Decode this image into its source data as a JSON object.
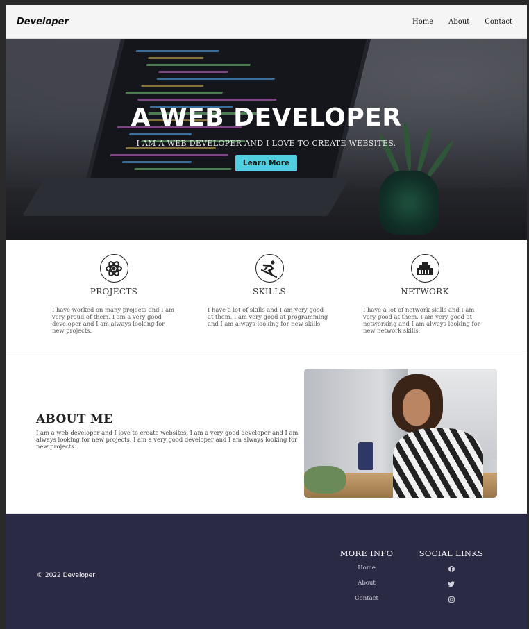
{
  "nav": {
    "logo": "Developer",
    "links": [
      "Home",
      "About",
      "Contact"
    ]
  },
  "hero": {
    "title": "A WEB DEVELOPER",
    "subtitle": "I AM A WEB DEVELOPER AND I LOVE TO CREATE WEBSITES.",
    "button_label": "Learn More"
  },
  "services": [
    {
      "icon": "atom-icon",
      "title": "PROJECTS",
      "text": "I have worked on many projects and I am very proud of them. I am a very good developer and I am always looking for new projects."
    },
    {
      "icon": "skier-icon",
      "title": "SKILLS",
      "text": "I have a lot of skills and I am very good at them. I am very good at programming and I am always looking for new skills."
    },
    {
      "icon": "network-icon",
      "title": "NETWORK",
      "text": "I have a lot of network skills and I am very good at them. I am very good at networking and I am always looking for new network skills."
    }
  ],
  "about": {
    "title": "ABOUT ME",
    "body": "I am a web developer and I love to create websites. I am a very good developer and I am always looking for new projects. I am a very good developer and I am always looking for new projects."
  },
  "footer": {
    "copyright": "© 2022 Developer",
    "more_info_title": "MORE INFO",
    "more_info_links": [
      "Home",
      "About",
      "Contact"
    ],
    "social_title": "SOCIAL LINKS",
    "social_icons": [
      "facebook-icon",
      "twitter-icon",
      "instagram-icon"
    ]
  },
  "colors": {
    "accent": "#4fcfdf",
    "footer_bg": "#2b2a44",
    "nav_bg": "#f5f5f5"
  }
}
